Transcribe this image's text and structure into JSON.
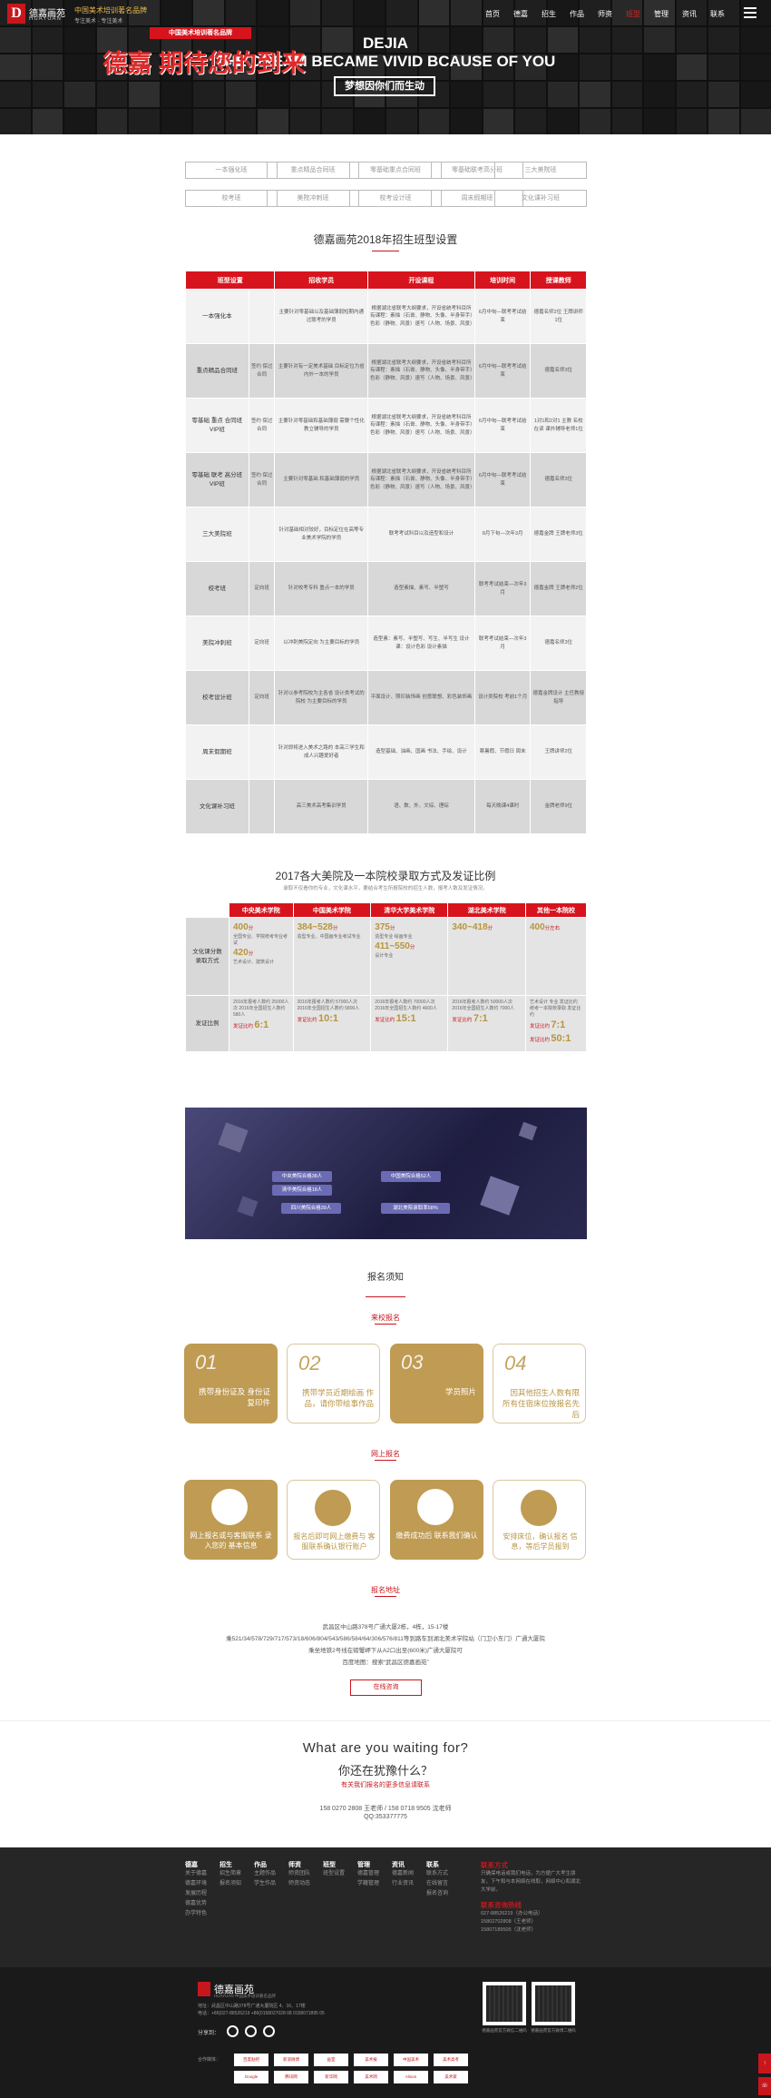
{
  "header": {
    "logo_cn": "德嘉画苑",
    "logo_en": "HUAYUAN",
    "slogan_main": "中国美术培训著名品牌",
    "slogan_sub": "专注美术 · 专注美术",
    "nav": [
      "首页",
      "德嘉",
      "招生",
      "作品",
      "师资",
      "班型",
      "管理",
      "资讯",
      "联系"
    ],
    "nav_active": 5
  },
  "hero": {
    "title1": "DEJIA",
    "title2": "THE DREAM BECAME VIVID BCAUSE OF YOU",
    "button": "梦想因你们而生动"
  },
  "class_buttons": [
    "一本强化班",
    "重点精品合同班",
    "零基础重点合同班",
    "零基础联考高分班",
    "三大美院班",
    "校考班",
    "美院冲刺班",
    "校考设计班",
    "周末假期班",
    "文化课补习班"
  ],
  "table1": {
    "title": "德嘉画苑2018年招生班型设置",
    "headers": [
      "班型设置",
      "招收学员",
      "开设课程",
      "培训时间",
      "授课教师"
    ],
    "rows": [
      {
        "name": "一本强化本",
        "sub": "",
        "type": "",
        "students": "主要针对零基础以及基础薄弱短期内通过联考的学员",
        "courses": "根据湖北省联考大纲要求，开设省统考科目所有课程：素描（石膏、静物、头像、半身带手）色彩（静物、风景）速写（人物、场景、风景）",
        "time": "6月中旬—联考考试结束",
        "teachers": "德嘉名师2位 王牌讲师1位"
      },
      {
        "name": "重点精品合同班",
        "sub": "",
        "type": "签约 保过 合同",
        "students": "主要针对有一定美术基础 目标定位为省内外一本的学员",
        "courses": "根据湖北省联考大纲要求，开设省统考科目所有课程：素描（石膏、静物、头像、半身带手）色彩（静物、风景）速写（人物、场景、风景）",
        "time": "6月中旬—联考考试结束",
        "teachers": "德嘉名师3位"
      },
      {
        "name": "零基础 重点 合同班",
        "sub": "VIP班",
        "type": "签约 保过 合同",
        "students": "主要针对零基础和基础薄弱 需要个性化教立辅导的学员",
        "courses": "根据湖北省联考大纲要求，开设省统考科目所有课程：素描（石膏、静物、头像、半身带手）色彩（静物、风景）速写（人物、场景、风景）",
        "time": "6月中旬—联考考试结束",
        "teachers": "1对1和2对1 主教 名校在读 课外辅导老师1位"
      },
      {
        "name": "零基础 联考 高分班",
        "sub": "VIP班",
        "type": "签约 保过 合同",
        "students": "主要针对零基础 和基础薄弱的学员",
        "courses": "根据湖北省联考大纲要求，开设省统考科目所有课程：素描（石膏、静物、头像、半身带手）色彩（静物、风景）速写（人物、场景、风景）",
        "time": "6月中旬—联考考试结束",
        "teachers": "德嘉名师3位"
      },
      {
        "name": "三大美院班",
        "sub": "",
        "type": "",
        "students": "针对基础相对较好，目标定位在高等专业美术学院的学员",
        "courses": "联考考试科目以及造型和设计",
        "time": "8月下旬—次年3月",
        "teachers": "德嘉金牌 王牌老师3位"
      },
      {
        "name": "校考班",
        "sub": "",
        "type": "定向班",
        "students": "针对校考专科 重点一本的学员",
        "courses": "造型素描、素写、半塑写",
        "time": "联考考试结束—次年3月",
        "teachers": "德嘉金牌 王牌老师2位"
      },
      {
        "name": "美院冲刺班",
        "sub": "",
        "type": "定向班",
        "students": "以冲刺美院定向 为主要目标的学员",
        "courses": "造型素：素写、半塑写、写生、半写生 设计课：设计色彩 设计素描",
        "time": "联考考试结束—次年3月",
        "teachers": "德嘉名师3位"
      },
      {
        "name": "校考设计班",
        "sub": "",
        "type": "定向班",
        "students": "针对以参考院校为主各省 设计类考试的院校 为主要目标的学员",
        "courses": "平面设计、照印装饰画 创意联想、彩色装饰画",
        "time": "设计类院校 考前1个月",
        "teachers": "德嘉金牌设计 主任教授指导"
      },
      {
        "name": "周末假期班",
        "sub": "",
        "type": "",
        "students": "针对即将进入美术之路的 本高三学生和成人兴趣爱好者",
        "courses": "造型基础、油画、国画 书法、手绘、设计",
        "time": "寒暑假、节假日 周末",
        "teachers": "王牌讲师2位"
      },
      {
        "name": "文化课补习班",
        "sub": "",
        "type": "",
        "students": "高三美术高考集训学员",
        "courses": "语、数、外、文综、理综",
        "time": "每天晚课4课时",
        "teachers": "金牌老师9位"
      }
    ]
  },
  "table2": {
    "title": "2017各大美院及一本院校录取方式及发证比例",
    "subtitle": "录取不仅看你的专业，文化课水平，要结合考生所报院校的招生人数，报考人数及发证情况。",
    "headers": [
      "",
      "中央美术学院",
      "中国美术学院",
      "清华大学美术学院",
      "湖北美术学院",
      "其他一本院校"
    ],
    "row1_name": "文化课分数 录取方式",
    "row1": [
      {
        "big": "400",
        "unit": "分",
        "text": "全国专业、学院统考专业考试",
        "big2": "420",
        "unit2": "分",
        "text2": "艺术设计、建筑设计"
      },
      {
        "big": "384~528",
        "unit": "分",
        "text": "造型专业、中国画专业考试专业",
        "big2": "",
        "unit2": "",
        "text2": ""
      },
      {
        "big": "375",
        "unit": "分",
        "text": "造型专业 绘画专业",
        "big2": "411~550",
        "unit2": "分",
        "text2": "设计专业"
      },
      {
        "big": "340~418",
        "unit": "分",
        "text": "",
        "big2": "",
        "unit2": "",
        "text2": ""
      },
      {
        "big": "400",
        "unit": "分左右",
        "text": "",
        "big2": "",
        "unit2": "",
        "text2": ""
      }
    ],
    "row2_name": "发证比例",
    "row2": [
      {
        "text": "2016年报考人数约 25000人次 2016年全国招生人数约 580人",
        "label": "发证比约",
        "ratio": "6:1"
      },
      {
        "text": "2016年报考人数约 57000人次 2016年全国招生人数约 5800人",
        "label": "发证比约",
        "ratio": "10:1"
      },
      {
        "text": "2016年报考人数约 70000人次 2016年全国招生人数约 4600人",
        "label": "发证比约",
        "ratio": "15:1"
      },
      {
        "text": "2016年报考人数约 50000人次 2016年全国招生人数约 7000人",
        "label": "发证比约",
        "ratio": "7:1"
      },
      {
        "text": "艺术设计 专业 发证比约 统考一本院校录取 发证比约",
        "label": "发证比约",
        "ratio": "7:1",
        "label2": "发证比约",
        "ratio2": "50:1"
      }
    ]
  },
  "banner": {
    "tag": "中国美术培训著名品牌",
    "main": "德嘉 期待您的到来",
    "pills": [
      "中央美院合格38人",
      "中国美院合格52人",
      "清华美院合格18人",
      "四川美院合格39人",
      "湖北美院录取率58%"
    ]
  },
  "registration": {
    "title": "报名须知",
    "onsite_label": "来校报名",
    "onsite": [
      {
        "num": "01",
        "text": "携带身份证及 身份证复印件"
      },
      {
        "num": "02",
        "text": "携带学员近期绘画 作品，请你带绘事作品"
      },
      {
        "num": "03",
        "text": "学员照片"
      },
      {
        "num": "04",
        "text": "因其他招生人数有限 所有住宿床位按报名先后"
      }
    ],
    "online_label": "网上报名",
    "online": [
      {
        "text": "网上报名或与客服联系 录入您的 基本信息"
      },
      {
        "text": "报名后即可网上缴费与 客服联系确认银行账户"
      },
      {
        "text": "缴费成功后 联系我们确认"
      },
      {
        "text": "安排床位，确认报名 信息，等后学员报到"
      }
    ],
    "address_label": "报名地址",
    "address_lines": [
      "武昌区中山路378号广通大厦2栋，4栋，15-17楼",
      "乘521/34/578/729/717/573/18/606/804/543/586/584/64/306/576/811等到路车到湖北美术学院站（门卫小东门）广通大厦院",
      "乘坐地铁2号线在螃蟹岬下从A2口出至(600米)广通大厦院可",
      "百度地图：搜索“武昌区德嘉画苑”"
    ],
    "consult_button": "在线咨询"
  },
  "cta": {
    "en": "What are you waiting for?",
    "cn": "你还在犹豫什么？",
    "red": "有关我们报名的更多信息请联系",
    "phone": "158 0270 2808 王老师 / 158 0718 9505 沈老师",
    "qq": "QQ:353377775"
  },
  "footer": {
    "columns": [
      {
        "title": "德嘉",
        "links": [
          "关于德嘉",
          "德嘉环境",
          "发展历程",
          "德嘉优势",
          "办学特色"
        ]
      },
      {
        "title": "招生",
        "links": [
          "招生简章",
          "报名须知"
        ]
      },
      {
        "title": "作品",
        "links": [
          "主题作品",
          "学生作品"
        ]
      },
      {
        "title": "师资",
        "links": [
          "师资团队",
          "师资动态"
        ]
      },
      {
        "title": "班型",
        "links": [
          "班型设置"
        ]
      },
      {
        "title": "管理",
        "links": [
          "德嘉管理",
          "学籍管理"
        ]
      },
      {
        "title": "资讯",
        "links": [
          "德嘉新闻",
          "行业资讯"
        ]
      },
      {
        "title": "联系",
        "links": [
          "联系方式",
          "在线留言",
          "报名咨询"
        ]
      }
    ],
    "contact_title": "联系方式",
    "contact_text": "只确保电话或我们电话，为方便广大考生朋友，下午和与本网络在线取，网络中心和湖北大学前，",
    "hotline_title": "联系咨询热线",
    "hotlines": [
      "027-88526219（办公电话）",
      "15802702808（王老师）",
      "15807189505（沈老师）"
    ],
    "logo": "德嘉画苑",
    "logo_sub": "HUAYUAN 中国美术培训著名品牌",
    "addr": "地址：武昌区中山路378号广通大厦院区 4、16、17楼",
    "tel": "电话：+86(027-88526219 +86(0158027028 08 0158071895 05",
    "share_label": "分享到：",
    "qr_captions": [
      "德嘉画苑官方微信二维码",
      "德嘉画苑官方微博二维码"
    ],
    "partners_label": "合作媒体：",
    "partners": [
      "百度贴吧",
      "新浪微博",
      "画室",
      "美术报",
      "中国美术",
      "美术高考",
      "Google",
      "腾讯网",
      "新华网",
      "美术网",
      "Alison",
      "美术家"
    ],
    "side": [
      "↑",
      "☏"
    ]
  }
}
